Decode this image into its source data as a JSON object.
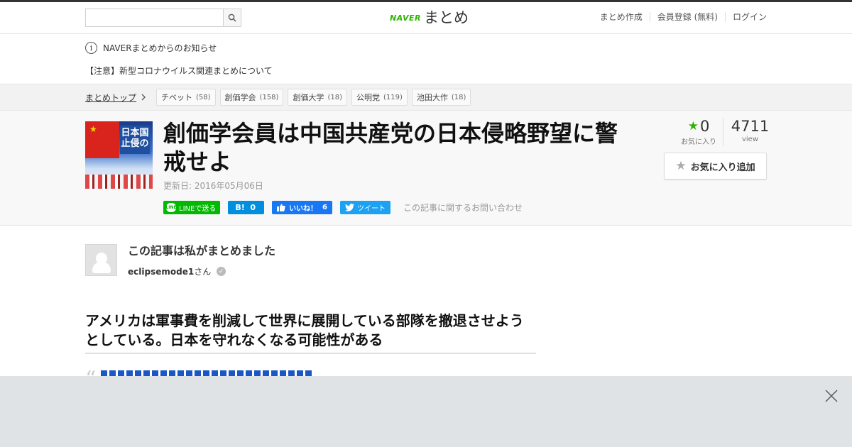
{
  "header": {
    "search_placeholder": "",
    "logo_brand": "NAVER",
    "logo_name": "まとめ",
    "nav": [
      "まとめ作成",
      "会員登録 (無料)",
      "ログイン"
    ]
  },
  "notice": {
    "title": "NAVERまとめからのお知らせ",
    "item": "【注意】新型コロナウイルス関連まとめについて"
  },
  "breadcrumb": {
    "top_label": "まとめトップ",
    "tags": [
      {
        "label": "チベット",
        "count": "(58)"
      },
      {
        "label": "創価学会",
        "count": "(158)"
      },
      {
        "label": "創価大学",
        "count": "(18)"
      },
      {
        "label": "公明党",
        "count": "(119)"
      },
      {
        "label": "池田大作",
        "count": "(18)"
      }
    ]
  },
  "article": {
    "title": "創価学会員は中国共産党の日本侵略野望に警戒せよ",
    "updated": "更新日: 2016年05月06日",
    "thumb_text": "日本国止侵の",
    "share": {
      "line": "LINEで送る",
      "hatena_label": "B!",
      "hatena_count": "0",
      "fb_label": "いいね！",
      "fb_count": "6",
      "tweet": "ツイート",
      "inquiry": "この記事に関するお問い合わせ"
    },
    "stats": {
      "fav_count": "0",
      "fav_label": "お気に入り",
      "view_count": "4711",
      "view_label": "view"
    },
    "fav_button": "お気に入り追加"
  },
  "author": {
    "heading": "この記事は私がまとめました",
    "name": "eclipsemode1",
    "suffix": "さん"
  },
  "content": {
    "heading": "アメリカは軍事費を削減して世界に展開している部隊を撤退させようとしている。日本を守れなくなる可能性がある"
  },
  "icons": {
    "search": "search-icon",
    "info": "info-icon",
    "chevron": "chevron-right-icon",
    "star": "star-icon",
    "close": "close-icon",
    "verified": "check-icon"
  },
  "colors": {
    "brand_green": "#2db400",
    "line_green": "#00b900",
    "hatena_blue": "#008fde",
    "facebook_blue": "#1877f2",
    "twitter_blue": "#1da1f2",
    "overlay_gray": "#e0e3e6"
  }
}
